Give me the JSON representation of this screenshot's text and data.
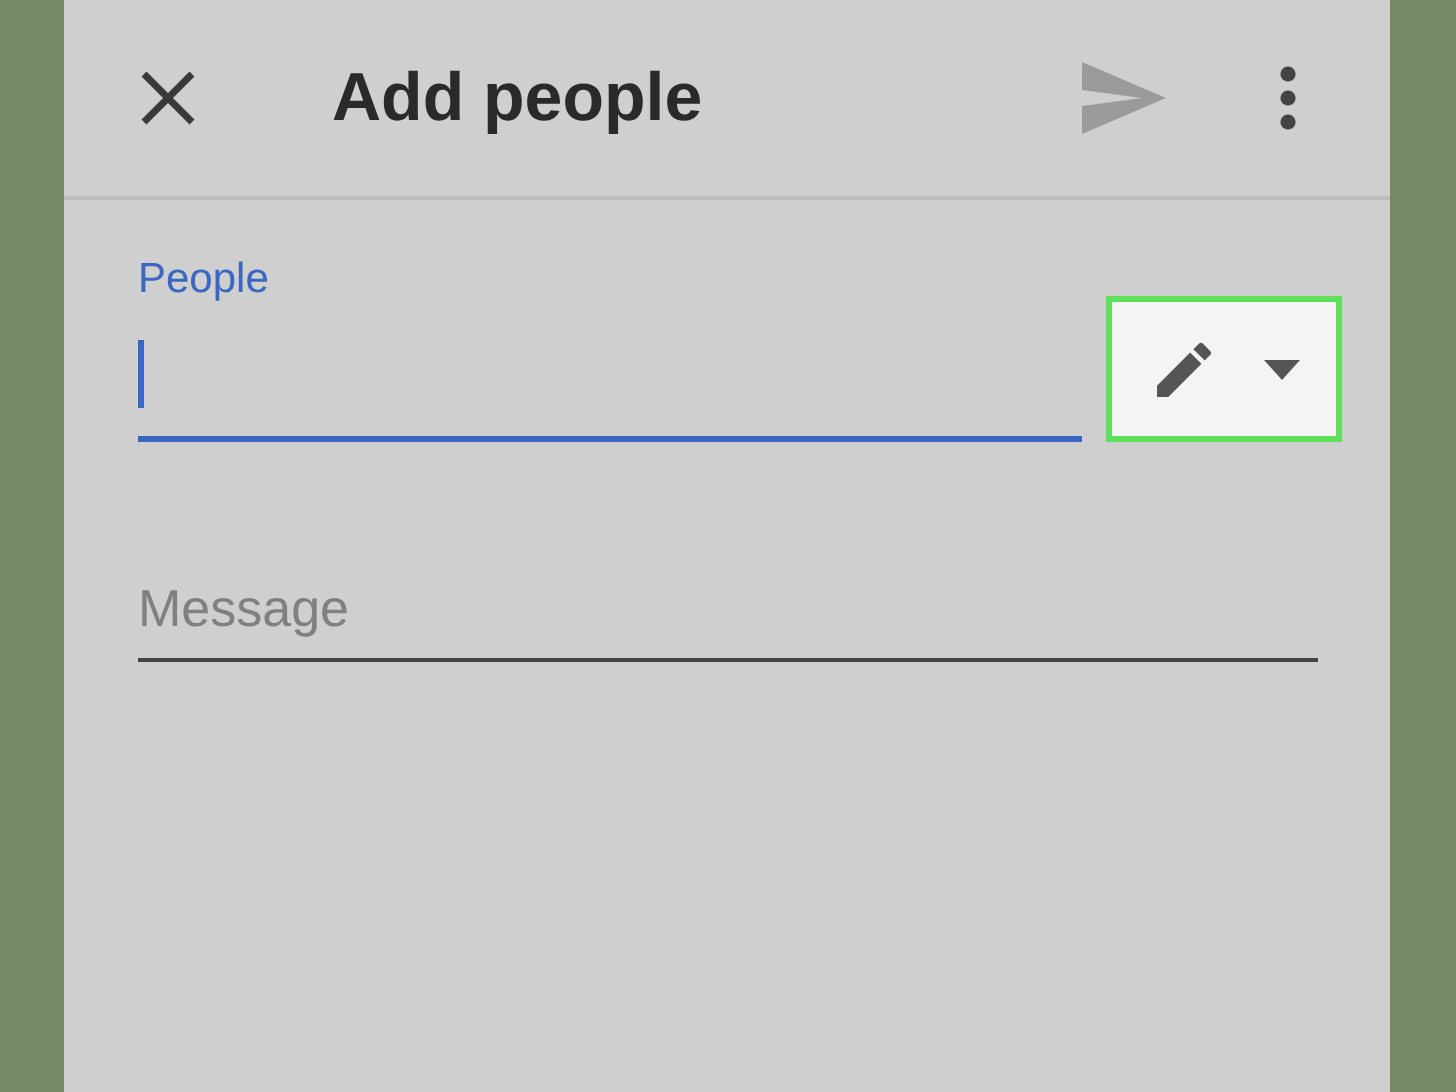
{
  "toolbar": {
    "title": "Add people"
  },
  "people_field": {
    "label": "People",
    "focused": true
  },
  "share_button": {
    "highlighted": true
  },
  "message_field": {
    "placeholder": "Message"
  }
}
